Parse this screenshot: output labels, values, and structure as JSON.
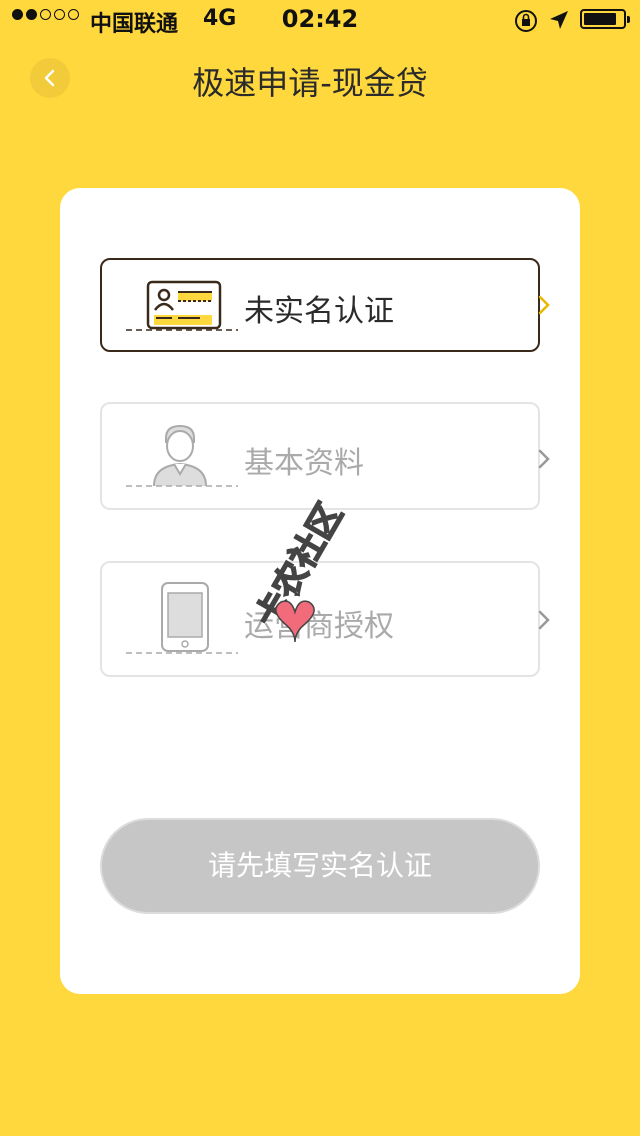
{
  "status_bar": {
    "carrier": "中国联通",
    "network": "4G",
    "time": "02:42"
  },
  "header": {
    "title": "极速申请-现金贷"
  },
  "steps": [
    {
      "label": "未实名认证",
      "active": true,
      "icon": "id-card-icon"
    },
    {
      "label": "基本资料",
      "active": false,
      "icon": "person-icon"
    },
    {
      "label": "运营商授权",
      "active": false,
      "icon": "phone-icon"
    }
  ],
  "submit": {
    "label": "请先填写实名认证",
    "enabled": false
  },
  "watermark": {
    "text": "卡农社区"
  },
  "colors": {
    "background": "#FFD83D",
    "card": "#FFFFFF",
    "active_border": "#3A2A1C",
    "disabled_button": "#C6C6C6"
  }
}
